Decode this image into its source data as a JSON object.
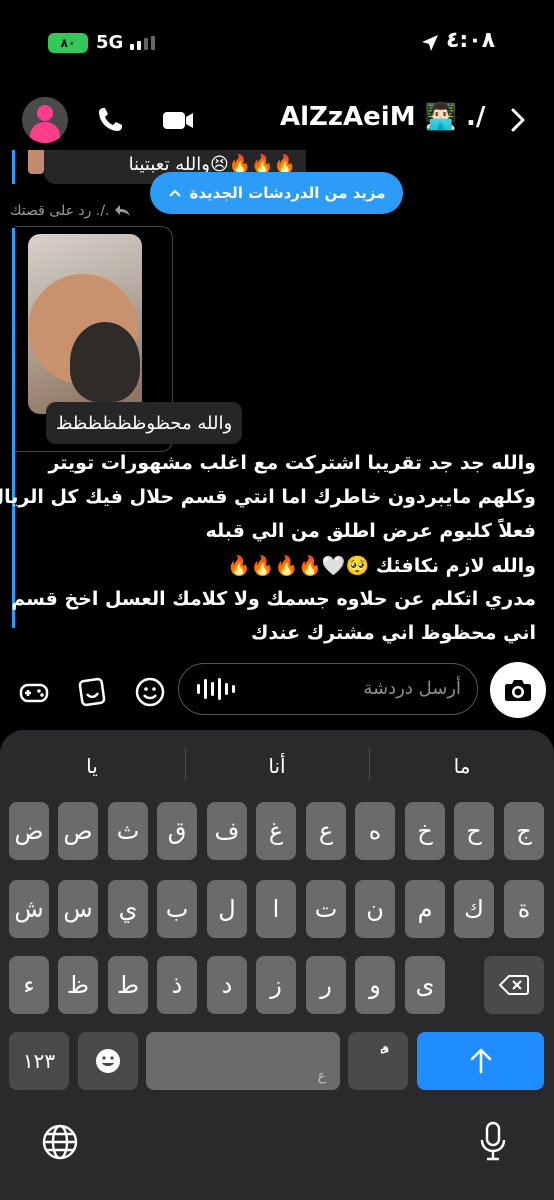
{
  "status": {
    "battery": "٨٠",
    "network": "5G",
    "time": "٤:٠٨"
  },
  "header": {
    "contact_name": "AlZzAeiM 👨🏻‍💻 ./",
    "avatar": "avatar-person-icon",
    "icons": [
      "phone-icon",
      "video-icon",
      "chevron-right-icon"
    ]
  },
  "chat": {
    "prev_message_fragment": "والله تعبتينا😣🔥🔥🔥",
    "new_chats_pill": "مزيد من الدردشات الجديدة",
    "reply_label": "رد على قصتك ./.",
    "photo_caption": "والله محظوظظظظظظ",
    "message_lines": [
      "والله جد جد تقريبا اشتركت مع اغلب مشهورات تويتر",
      "وكلهم مايبردون خاطرك اما انتي قسم حلال فيك كل الريال",
      "فعلاً كليوم عرض اطلق من الي قبله",
      "والله لازم نكافئك 🥺🤍🔥🔥🔥🔥",
      "مدري اتكلم عن حلاوه جسمك ولا كلامك العسل اخخ قسم",
      "اني محظوظ اني مشترك عندك"
    ]
  },
  "composer": {
    "placeholder": "أرسل دردشة",
    "icons": [
      "game-controller-icon",
      "sticker-icon",
      "emoji-icon",
      "voice-wave-icon",
      "camera-icon"
    ]
  },
  "keyboard": {
    "suggestions": [
      "ما",
      "أنا",
      "يا"
    ],
    "row1": [
      "ج",
      "ح",
      "خ",
      "ه",
      "ع",
      "غ",
      "ف",
      "ق",
      "ث",
      "ص",
      "ض"
    ],
    "row2": [
      "ة",
      "ك",
      "م",
      "ن",
      "ت",
      "ا",
      "ل",
      "ب",
      "ي",
      "س",
      "ش"
    ],
    "row3": [
      "ى",
      "و",
      "ر",
      "ز",
      "د",
      "ذ",
      "ط",
      "ظ",
      "ء"
    ],
    "numbers_key": "١٢٣",
    "space_hint": "ع",
    "diacritic_key": "ًٌ"
  },
  "colors": {
    "accent_blue": "#2d9cf6",
    "send_blue": "#1f8cff",
    "battery_green": "#34c759",
    "avatar_pink": "#ff3d8a"
  }
}
